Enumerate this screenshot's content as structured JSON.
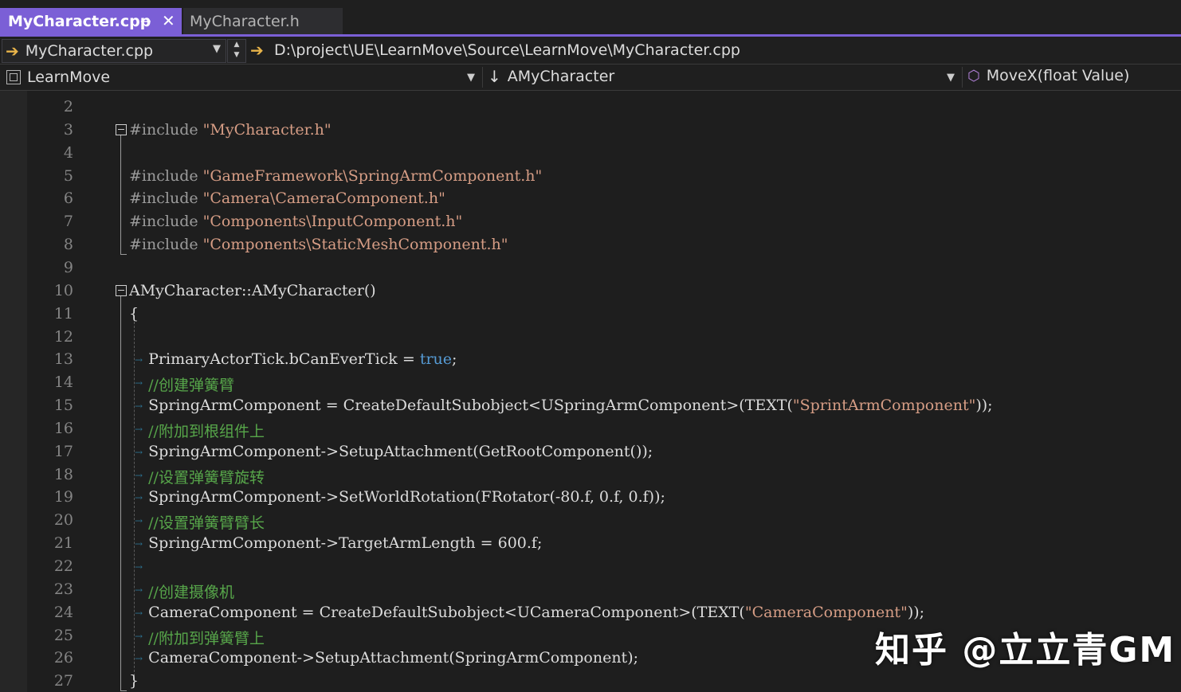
{
  "tabs": [
    {
      "label": "MyCharacter.cpp",
      "active": true
    },
    {
      "label": "MyCharacter.h",
      "active": false
    }
  ],
  "path_bar": {
    "file": "MyCharacter.cpp",
    "path": "D:\\project\\UE\\LearnMove\\Source\\LearnMove\\MyCharacter.cpp"
  },
  "nav_bar": {
    "project": "LearnMove",
    "class": "AMyCharacter",
    "member": "MoveX(float Value)"
  },
  "colors": {
    "accent": "#7b5fd6",
    "string": "#d69d85",
    "comment": "#57a64a",
    "keyword": "#569cd6"
  },
  "code_lines": [
    {
      "n": "2"
    },
    {
      "n": "3",
      "pp": "#include ",
      "str": "\"MyCharacter.h\""
    },
    {
      "n": "4"
    },
    {
      "n": "5",
      "pp": "#include ",
      "str": "\"GameFramework\\SpringArmComponent.h\""
    },
    {
      "n": "6",
      "pp": "#include ",
      "str": "\"Camera\\CameraComponent.h\""
    },
    {
      "n": "7",
      "pp": "#include ",
      "str": "\"Components\\InputComponent.h\""
    },
    {
      "n": "8",
      "pp": "#include ",
      "str": "\"Components\\StaticMeshComponent.h\""
    },
    {
      "n": "9"
    },
    {
      "n": "10",
      "text": "AMyCharacter::AMyCharacter()"
    },
    {
      "n": "11",
      "text": "{"
    },
    {
      "n": "12"
    },
    {
      "n": "13",
      "text": "    PrimaryActorTick.bCanEverTick = ",
      "kw": "true",
      "tail": ";"
    },
    {
      "n": "14",
      "cmt": "    //创建弹簧臂"
    },
    {
      "n": "15",
      "text": "    SpringArmComponent = CreateDefaultSubobject<USpringArmComponent>(TEXT(",
      "str": "\"SprintArmComponent\"",
      "tail": "));"
    },
    {
      "n": "16",
      "cmt": "    //附加到根组件上"
    },
    {
      "n": "17",
      "text": "    SpringArmComponent->SetupAttachment(GetRootComponent());"
    },
    {
      "n": "18",
      "cmt": "    //设置弹簧臂旋转"
    },
    {
      "n": "19",
      "text": "    SpringArmComponent->SetWorldRotation(FRotator(-80.f, 0.f, 0.f));"
    },
    {
      "n": "20",
      "cmt": "    //设置弹簧臂臂长"
    },
    {
      "n": "21",
      "text": "    SpringArmComponent->TargetArmLength = 600.f;"
    },
    {
      "n": "22"
    },
    {
      "n": "23",
      "cmt": "    //创建摄像机"
    },
    {
      "n": "24",
      "text": "    CameraComponent = CreateDefaultSubobject<UCameraComponent>(TEXT(",
      "str": "\"CameraComponent\"",
      "tail": "));"
    },
    {
      "n": "25",
      "cmt": "    //附加到弹簧臂上"
    },
    {
      "n": "26",
      "text": "    CameraComponent->SetupAttachment(SpringArmComponent);"
    },
    {
      "n": "27",
      "text": "}"
    }
  ],
  "watermark": "知乎 @立立青GM"
}
